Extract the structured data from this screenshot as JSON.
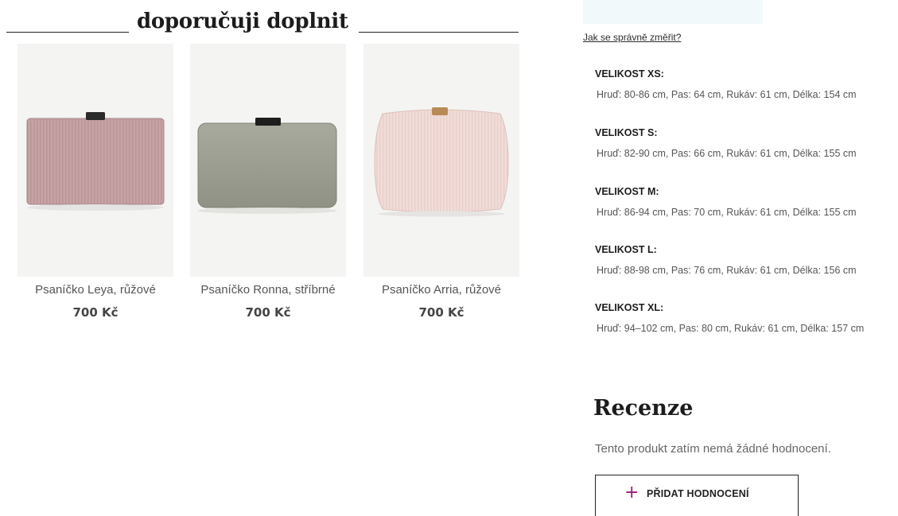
{
  "recommend": {
    "title": "doporučuji doplnit",
    "products": [
      {
        "name": "Psaníčko Leya, růžové",
        "price": "700 Kč",
        "color": "#c9a6a8",
        "clasp": "#2b2b2b"
      },
      {
        "name": "Psaníčko Ronna, stříbrné",
        "price": "700 Kč",
        "color": "#9ea193",
        "clasp": "#1e1e1e"
      },
      {
        "name": "Psaníčko Arria, růžové",
        "price": "700 Kč",
        "color": "#f1dcd8",
        "clasp": "#b88a55"
      }
    ]
  },
  "sizes": {
    "measure_link": "Jak se správně změřit?",
    "items": [
      {
        "title": "VELIKOST XS:",
        "desc": "Hruď: 80-86 cm, Pas: 64 cm, Rukáv: 61 cm, Délka: 154 cm"
      },
      {
        "title": "VELIKOST S:",
        "desc": "Hruď: 82-90 cm, Pas: 66 cm, Rukáv: 61 cm, Délka: 155 cm"
      },
      {
        "title": "VELIKOST M:",
        "desc": "Hruď: 86-94 cm, Pas: 70 cm, Rukáv: 61 cm, Délka: 155 cm"
      },
      {
        "title": "VELIKOST L:",
        "desc": "Hruď: 88-98 cm, Pas: 76 cm, Rukáv: 61 cm, Délka: 156 cm"
      },
      {
        "title": "VELIKOST XL:",
        "desc": "Hruď: 94–102 cm, Pas: 80 cm, Rukáv: 61 cm, Délka: 157 cm"
      }
    ]
  },
  "reviews": {
    "title": "Recenze",
    "empty_text": "Tento produkt zatím nemá žádné hodnocení.",
    "add_label": "PŘIDAT HODNOCENÍ",
    "add_icon": "+",
    "accent": "#9b1b7a"
  }
}
